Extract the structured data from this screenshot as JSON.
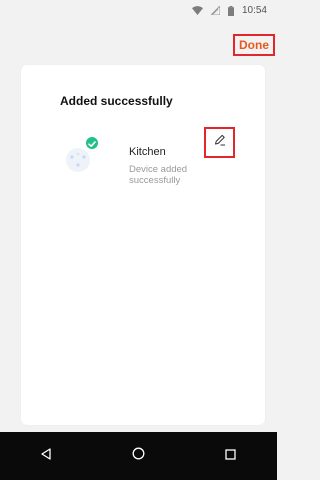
{
  "status_bar": {
    "time": "10:54",
    "icons": [
      "wifi-icon",
      "signal-icon",
      "battery-icon"
    ]
  },
  "header": {
    "done_label": "Done",
    "done_color": "#e85a1c"
  },
  "card": {
    "title": "Added successfully",
    "device": {
      "name": "Kitchen",
      "status": "Device added successfully",
      "badge_color": "#23c08a",
      "edit_icon": "pencil-icon"
    }
  },
  "nav_bar": {
    "buttons": [
      "back-icon",
      "home-icon",
      "recents-icon"
    ]
  }
}
